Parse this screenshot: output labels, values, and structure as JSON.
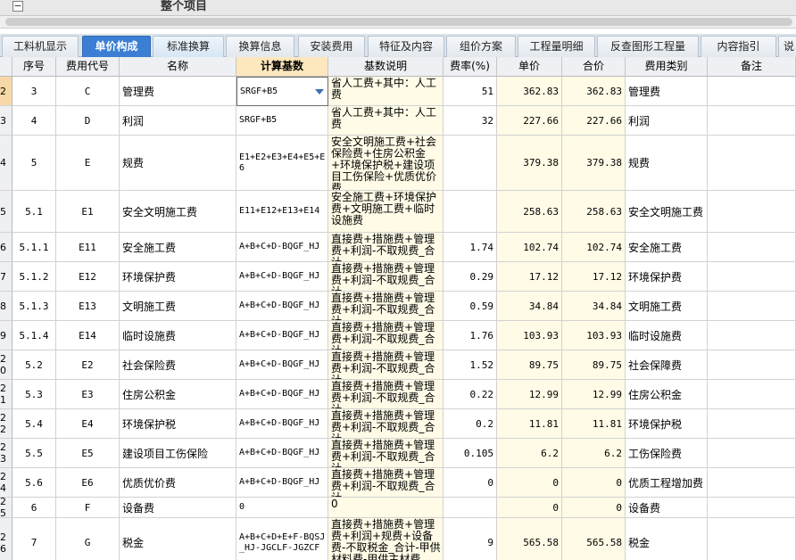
{
  "project_title": "整个项目",
  "collapse_symbol": "−",
  "tabs": [
    {
      "label": "工料机显示",
      "active": false
    },
    {
      "label": "单价构成",
      "active": true
    },
    {
      "label": "标准换算",
      "active": false
    },
    {
      "label": "换算信息",
      "active": false
    },
    {
      "label": "安装费用",
      "active": false
    },
    {
      "label": "特征及内容",
      "active": false
    },
    {
      "label": "组价方案",
      "active": false
    },
    {
      "label": "工程量明细",
      "active": false
    },
    {
      "label": "反查图形工程量",
      "active": false
    },
    {
      "label": "内容指引",
      "active": false
    },
    {
      "label": "说",
      "active": false
    }
  ],
  "columns": [
    "序号",
    "费用代号",
    "名称",
    "计算基数",
    "基数说明",
    "费率(%)",
    "单价",
    "合价",
    "费用类别",
    "备注"
  ],
  "rows": [
    {
      "rn": "2",
      "seq": "3",
      "code": "C",
      "name": "管理费",
      "base": "SRGF+B5",
      "desc": "省人工费+其中：人工费",
      "rate": "51",
      "price": "362.83",
      "total": "362.83",
      "cat": "管理费",
      "note": ""
    },
    {
      "rn": "3",
      "seq": "4",
      "code": "D",
      "name": "利润",
      "base": "SRGF+B5",
      "desc": "省人工费+其中：人工费",
      "rate": "32",
      "price": "227.66",
      "total": "227.66",
      "cat": "利润",
      "note": ""
    },
    {
      "rn": "4",
      "seq": "5",
      "code": "E",
      "name": "规费",
      "base": "E1+E2+E3+E4+E5+E6",
      "desc": "安全文明施工费+社会保险费+住房公积金+环境保护税+建设项目工伤保险+优质优价费",
      "rate": "",
      "price": "379.38",
      "total": "379.38",
      "cat": "规费",
      "note": ""
    },
    {
      "rn": "5",
      "seq": "5.1",
      "code": "E1",
      "name": "安全文明施工费",
      "base": "E11+E12+E13+E14",
      "desc": "安全施工费+环境保护费+文明施工费+临时设施费",
      "rate": "",
      "price": "258.63",
      "total": "258.63",
      "cat": "安全文明施工费",
      "note": ""
    },
    {
      "rn": "6",
      "seq": "5.1.1",
      "code": "E11",
      "name": "安全施工费",
      "base": "A+B+C+D-BQGF_HJ",
      "desc": "直接费+措施费+管理费+利润-不取规费_合计",
      "rate": "1.74",
      "price": "102.74",
      "total": "102.74",
      "cat": "安全施工费",
      "note": ""
    },
    {
      "rn": "7",
      "seq": "5.1.2",
      "code": "E12",
      "name": "环境保护费",
      "base": "A+B+C+D-BQGF_HJ",
      "desc": "直接费+措施费+管理费+利润-不取规费_合计",
      "rate": "0.29",
      "price": "17.12",
      "total": "17.12",
      "cat": "环境保护费",
      "note": ""
    },
    {
      "rn": "8",
      "seq": "5.1.3",
      "code": "E13",
      "name": "文明施工费",
      "base": "A+B+C+D-BQGF_HJ",
      "desc": "直接费+措施费+管理费+利润-不取规费_合计",
      "rate": "0.59",
      "price": "34.84",
      "total": "34.84",
      "cat": "文明施工费",
      "note": ""
    },
    {
      "rn": "9",
      "seq": "5.1.4",
      "code": "E14",
      "name": "临时设施费",
      "base": "A+B+C+D-BQGF_HJ",
      "desc": "直接费+措施费+管理费+利润-不取规费_合计",
      "rate": "1.76",
      "price": "103.93",
      "total": "103.93",
      "cat": "临时设施费",
      "note": ""
    },
    {
      "rn": "20",
      "seq": "5.2",
      "code": "E2",
      "name": "社会保险费",
      "base": "A+B+C+D-BQGF_HJ",
      "desc": "直接费+措施费+管理费+利润-不取规费_合计",
      "rate": "1.52",
      "price": "89.75",
      "total": "89.75",
      "cat": "社会保障费",
      "note": ""
    },
    {
      "rn": "21",
      "seq": "5.3",
      "code": "E3",
      "name": "住房公积金",
      "base": "A+B+C+D-BQGF_HJ",
      "desc": "直接费+措施费+管理费+利润-不取规费_合计",
      "rate": "0.22",
      "price": "12.99",
      "total": "12.99",
      "cat": "住房公积金",
      "note": ""
    },
    {
      "rn": "22",
      "seq": "5.4",
      "code": "E4",
      "name": "环境保护税",
      "base": "A+B+C+D-BQGF_HJ",
      "desc": "直接费+措施费+管理费+利润-不取规费_合计",
      "rate": "0.2",
      "price": "11.81",
      "total": "11.81",
      "cat": "环境保护税",
      "note": ""
    },
    {
      "rn": "23",
      "seq": "5.5",
      "code": "E5",
      "name": "建设项目工伤保险",
      "base": "A+B+C+D-BQGF_HJ",
      "desc": "直接费+措施费+管理费+利润-不取规费_合计",
      "rate": "0.105",
      "price": "6.2",
      "total": "6.2",
      "cat": "工伤保险费",
      "note": ""
    },
    {
      "rn": "24",
      "seq": "5.6",
      "code": "E6",
      "name": "优质优价费",
      "base": "A+B+C+D-BQGF_HJ",
      "desc": "直接费+措施费+管理费+利润-不取规费_合计",
      "rate": "0",
      "price": "0",
      "total": "0",
      "cat": "优质工程增加费",
      "note": ""
    },
    {
      "rn": "25",
      "seq": "6",
      "code": "F",
      "name": "设备费",
      "base": "0",
      "desc": "0",
      "rate": "",
      "price": "0",
      "total": "0",
      "cat": "设备费",
      "note": ""
    },
    {
      "rn": "26",
      "seq": "7",
      "code": "G",
      "name": "税金",
      "base": "A+B+C+D+E+F-BQSJ_HJ-JGCLF-JGZCF",
      "desc": "直接费+措施费+管理费+利润+规费+设备费-不取税金_合计-甲供材料费-甲供主材费",
      "rate": "9",
      "price": "565.58",
      "total": "565.58",
      "cat": "税金",
      "note": ""
    }
  ]
}
